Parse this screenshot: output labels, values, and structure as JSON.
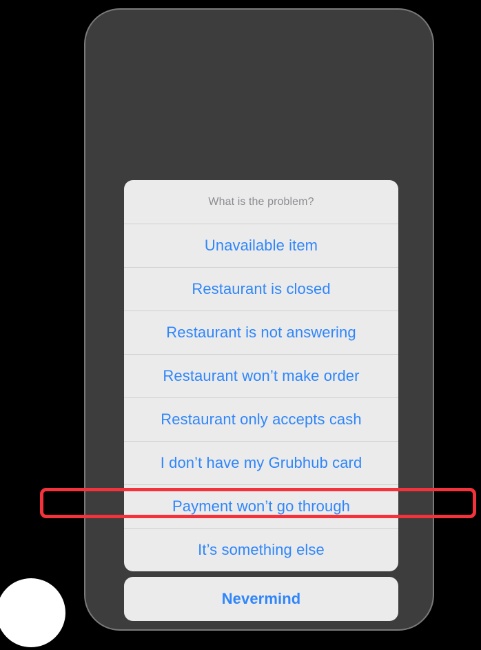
{
  "device": {
    "frame_color": "#3d3d3d",
    "bezel_color": "#7a7a7a",
    "background_color": "#000000"
  },
  "decor": {
    "circle_color": "#ffffff"
  },
  "action_sheet": {
    "header": "What is the problem?",
    "accent_color": "#2f86fa",
    "surface_color": "#ebebeb",
    "header_color": "#8c8c91",
    "options": [
      {
        "label": "Unavailable item"
      },
      {
        "label": "Restaurant is closed"
      },
      {
        "label": "Restaurant is not answering"
      },
      {
        "label": "Restaurant won’t make order"
      },
      {
        "label": "Restaurant only accepts cash"
      },
      {
        "label": "I don’t have my Grubhub card"
      },
      {
        "label": "Payment won’t go through"
      },
      {
        "label": "It’s something else"
      }
    ],
    "cancel": {
      "label": "Nevermind"
    }
  },
  "annotation": {
    "color": "#f4323c",
    "target_option_index": 6
  }
}
